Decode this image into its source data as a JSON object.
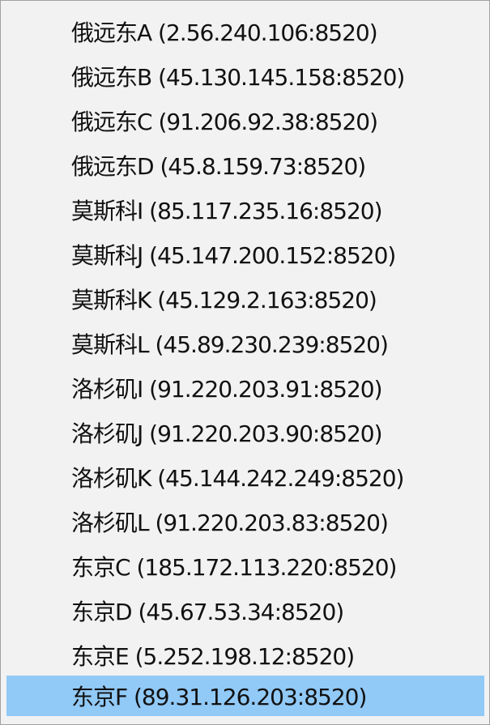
{
  "menu": {
    "selected_index": 15,
    "selected_color": "#91c9f7",
    "items": [
      {
        "label": "俄远东A (2.56.240.106:8520)"
      },
      {
        "label": "俄远东B (45.130.145.158:8520)"
      },
      {
        "label": "俄远东C (91.206.92.38:8520)"
      },
      {
        "label": "俄远东D (45.8.159.73:8520)"
      },
      {
        "label": "莫斯科I (85.117.235.16:8520)"
      },
      {
        "label": "莫斯科J (45.147.200.152:8520)"
      },
      {
        "label": "莫斯科K (45.129.2.163:8520)"
      },
      {
        "label": "莫斯科L (45.89.230.239:8520)"
      },
      {
        "label": "洛杉矶I (91.220.203.91:8520)"
      },
      {
        "label": "洛杉矶J (91.220.203.90:8520)"
      },
      {
        "label": "洛杉矶K (45.144.242.249:8520)"
      },
      {
        "label": "洛杉矶L (91.220.203.83:8520)"
      },
      {
        "label": "东京C (185.172.113.220:8520)"
      },
      {
        "label": "东京D (45.67.53.34:8520)"
      },
      {
        "label": "东京E (5.252.198.12:8520)"
      },
      {
        "label": "东京F (89.31.126.203:8520)"
      }
    ]
  }
}
